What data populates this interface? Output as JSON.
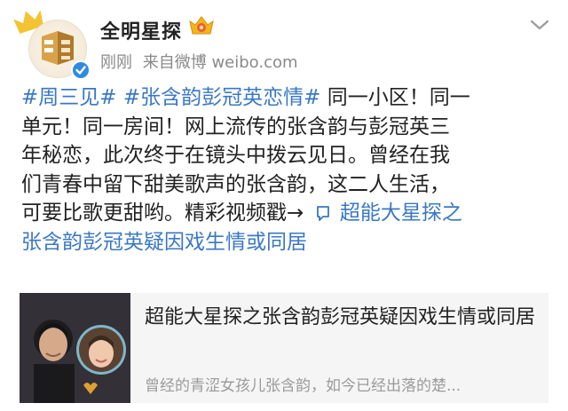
{
  "header": {
    "user_name": "全明星探",
    "time": "刚刚",
    "source": "来自微博 weibo.com"
  },
  "post": {
    "lines": [
      [
        "#周三见#",
        " ",
        "#张含韵彭冠英恋情#",
        " 同一小区！同一"
      ],
      "单元！同一房间！网上流传的张含韵与彭冠英三",
      "年秘恋，此次终于在镜头中拨云见日。曾经在我",
      "们青春中留下甜美歌声的张含韵，这二人生活，",
      "可要比歌更甜哟。精彩视频戳→"
    ],
    "hashtag_1": "#周三见#",
    "hashtag_2": "#张含韵彭冠英恋情#",
    "line1_rest": " 同一小区！同一",
    "line2": "单元！同一房间！网上流传的张含韵与彭冠英三",
    "line3": "年秘恋，此次终于在镜头中拨云见日。曾经在我",
    "line4": "们青春中留下甜美歌声的张含韵，这二人生活，",
    "line5_text": "可要比歌更甜哟。精彩视频戳→",
    "link_part1": "超能大星探之",
    "link_part2": "张含韵彭冠英疑因戏生情或同居"
  },
  "card": {
    "title": "超能大星探之张含韵彭冠英疑因戏生情或同居",
    "description": "曾经的青涩女孩儿张含韵，如今已经出落的楚..."
  },
  "icons": {
    "crown": "crown-icon",
    "vip": "vip-crown-icon",
    "verified": "verified-badge-icon",
    "dropdown": "chevron-down-icon",
    "video_link": "video-link-icon"
  },
  "colors": {
    "link": "#3a78c4",
    "text": "#222222",
    "meta": "#8a8a8a",
    "card_bg": "#f5f5f5",
    "crown": "#f3c332",
    "verified": "#2f8be0"
  }
}
